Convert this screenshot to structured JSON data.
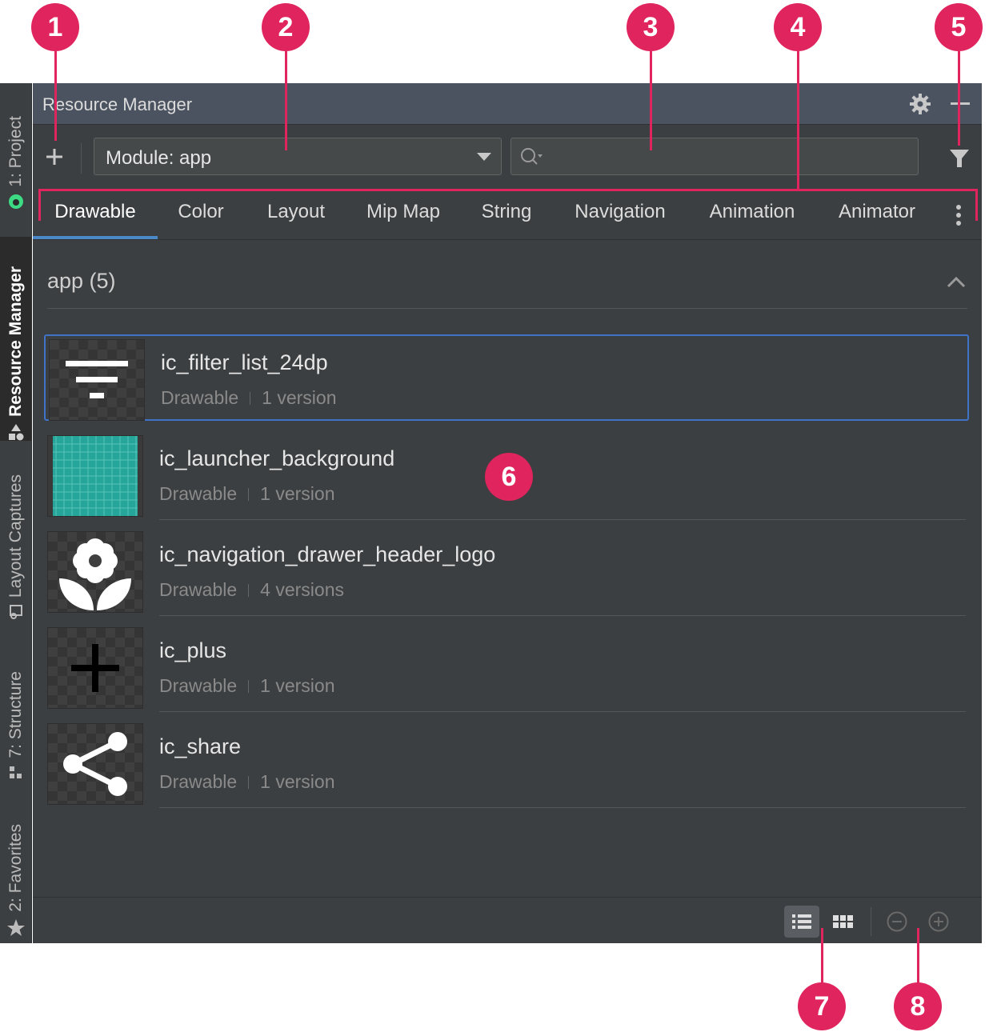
{
  "side_tabs": [
    {
      "label": "1: Project",
      "icon": "android-icon"
    },
    {
      "label": "Resource Manager",
      "icon": "shapes-icon",
      "active": true
    },
    {
      "label": "Layout Captures",
      "icon": "capture-icon"
    },
    {
      "label": "7: Structure",
      "icon": "structure-icon"
    },
    {
      "label": "2: Favorites",
      "icon": "star-icon"
    }
  ],
  "window": {
    "title": "Resource Manager"
  },
  "toolbar": {
    "module_value": "Module: app",
    "search_value": ""
  },
  "tabs": [
    "Drawable",
    "Color",
    "Layout",
    "Mip Map",
    "String",
    "Navigation",
    "Animation",
    "Animator"
  ],
  "active_tab": "Drawable",
  "section": {
    "label": "app (5)"
  },
  "resources": [
    {
      "name": "ic_filter_list_24dp",
      "type": "Drawable",
      "versions": "1 version",
      "preview": "filter-list-icon"
    },
    {
      "name": "ic_launcher_background",
      "type": "Drawable",
      "versions": "1 version",
      "preview": "launcher-background-grid"
    },
    {
      "name": "ic_navigation_drawer_header_logo",
      "type": "Drawable",
      "versions": "4 versions",
      "preview": "flower-icon"
    },
    {
      "name": "ic_plus",
      "type": "Drawable",
      "versions": "1 version",
      "preview": "plus-icon"
    },
    {
      "name": "ic_share",
      "type": "Drawable",
      "versions": "1 version",
      "preview": "share-icon"
    }
  ],
  "callouts": [
    "1",
    "2",
    "3",
    "4",
    "5",
    "6",
    "7",
    "8"
  ],
  "colors": {
    "callout": "#e0245e",
    "panel": "#3c3f41",
    "titlebar": "#4c5360",
    "selection": "#3f73c7",
    "tab_underline": "#4a88c7",
    "launcher_teal": "#26a69a"
  }
}
